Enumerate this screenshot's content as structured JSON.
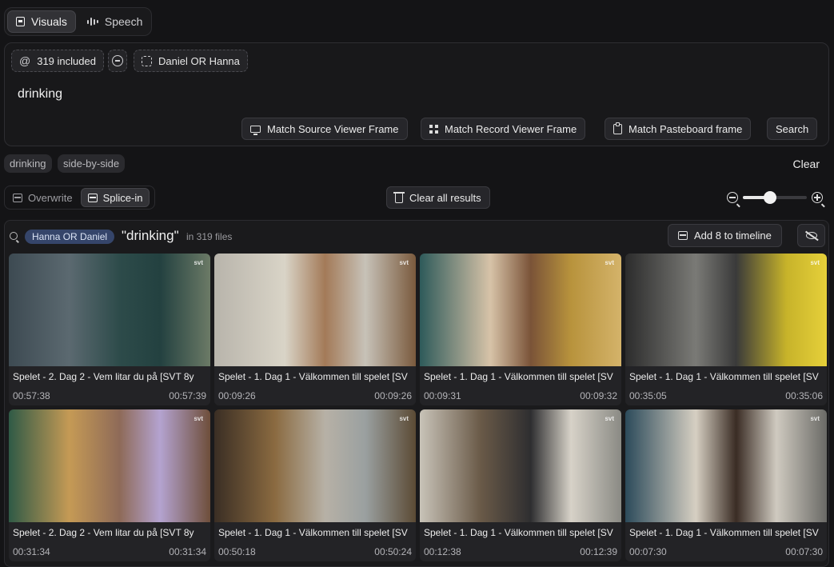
{
  "modes": {
    "visuals": "Visuals",
    "speech": "Speech"
  },
  "filters": {
    "included_at": "@",
    "included": "319 included",
    "person": "Daniel OR Hanna"
  },
  "query": "drinking",
  "actions": {
    "match_source": "Match Source Viewer Frame",
    "match_record": "Match Record Viewer Frame",
    "match_pasteboard": "Match Pasteboard frame",
    "search": "Search"
  },
  "recent_tags": [
    "drinking",
    "side-by-side"
  ],
  "clear": "Clear",
  "edit_modes": {
    "overwrite": "Overwrite",
    "splice": "Splice-in"
  },
  "clear_all": "Clear all results",
  "zoom_level": 0.43,
  "results": {
    "person_badge": "Hanna OR Daniel",
    "query": "\"drinking\"",
    "count": "in 319 files",
    "add_button": "Add 8 to timeline",
    "clips": [
      {
        "title": "Spelet - 2. Dag 2 - Vem litar du på [SVT 8y",
        "in": "00:57:38",
        "out": "00:57:39"
      },
      {
        "title": "Spelet - 1. Dag 1 - Välkommen till spelet [SV",
        "in": "00:09:26",
        "out": "00:09:26"
      },
      {
        "title": "Spelet - 1. Dag 1 - Välkommen till spelet [SV",
        "in": "00:09:31",
        "out": "00:09:32"
      },
      {
        "title": "Spelet - 1. Dag 1 - Välkommen till spelet [SV",
        "in": "00:35:05",
        "out": "00:35:06"
      },
      {
        "title": "Spelet - 2. Dag 2 - Vem litar du på [SVT 8y",
        "in": "00:31:34",
        "out": "00:31:34"
      },
      {
        "title": "Spelet - 1. Dag 1 - Välkommen till spelet [SV",
        "in": "00:50:18",
        "out": "00:50:24"
      },
      {
        "title": "Spelet - 1. Dag 1 - Välkommen till spelet [SV",
        "in": "00:12:38",
        "out": "00:12:39"
      },
      {
        "title": "Spelet - 1. Dag 1 - Välkommen till spelet [SV",
        "in": "00:07:30",
        "out": "00:07:30"
      }
    ]
  },
  "watermark": "svt"
}
